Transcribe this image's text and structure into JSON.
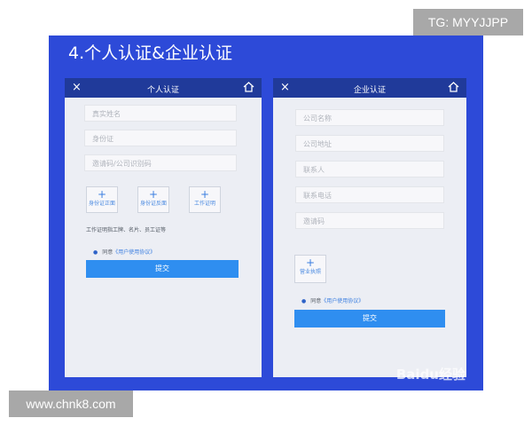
{
  "slide": {
    "title": "4.个人认证&企业认证"
  },
  "personal": {
    "close_icon": "×",
    "title": "个人认证",
    "home_icon": "home-icon",
    "fields": [
      "真实姓名",
      "身份证",
      "邀请码/公司识别码"
    ],
    "uploads": [
      "身份证正面",
      "身份证反面",
      "工作证明"
    ],
    "uploads_plus": "+",
    "note": "工作证明指工牌、名片、员工证等",
    "agree_prefix": "同意",
    "agree_link": "《用户使用协议》",
    "submit": "提交"
  },
  "enterprise": {
    "close_icon": "×",
    "title": "企业认证",
    "home_icon": "home-icon",
    "fields": [
      "公司名称",
      "公司地址",
      "联系人",
      "联系电话",
      "邀请码"
    ],
    "upload": "营业执照",
    "upload_plus": "+",
    "agree_prefix": "同意",
    "agree_link": "《用户使用协议》",
    "submit": "提交"
  },
  "watermark": "Baidu经验",
  "tag_top_right": "TG: MYYJJPP",
  "tag_bottom_left": "www.chnk8.com",
  "colors": {
    "slide_bg": "#2d4ad8",
    "header_bg": "#203a9a",
    "submit_bg": "#2f8ef0",
    "tag_bg": "#a8a8a8"
  }
}
